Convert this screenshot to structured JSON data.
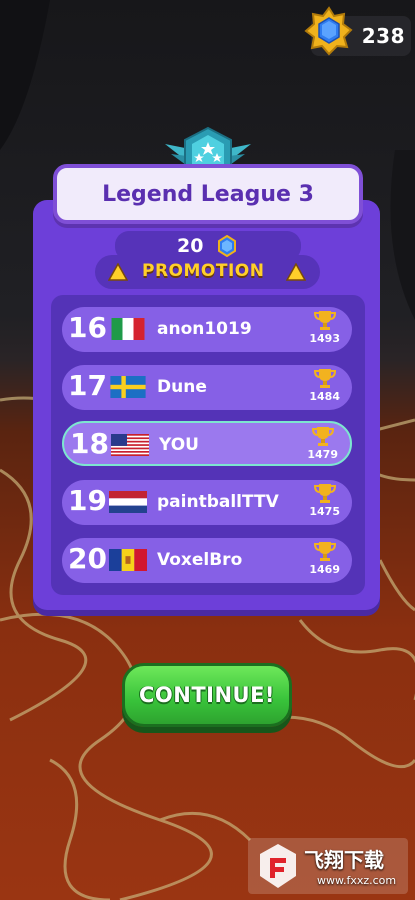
{
  "currency": {
    "gems": "238"
  },
  "league": {
    "title": "Legend League 3"
  },
  "promotion": {
    "count": "20",
    "label": "PROMOTION"
  },
  "leaderboard": [
    {
      "rank": "16",
      "flag": "Italy",
      "name": "anon1019",
      "score": "1493",
      "highlight": false
    },
    {
      "rank": "17",
      "flag": "Sweden",
      "name": "Dune",
      "score": "1484",
      "highlight": false
    },
    {
      "rank": "18",
      "flag": "United States",
      "name": "YOU",
      "score": "1479",
      "highlight": true
    },
    {
      "rank": "19",
      "flag": "Netherlands",
      "name": "paintballTTV",
      "score": "1475",
      "highlight": false
    },
    {
      "rank": "20",
      "flag": "Andorra",
      "name": "VoxelBro",
      "score": "1469",
      "highlight": false
    }
  ],
  "actions": {
    "continue_label": "CONTINUE!"
  },
  "watermark": {
    "title": "飞翔下载",
    "url": "www.fxxz.com"
  },
  "colors": {
    "panel": "#6d3fd9",
    "row": "#8660e6",
    "promotion_text": "#ffcf2a",
    "button": "#38c23a"
  }
}
